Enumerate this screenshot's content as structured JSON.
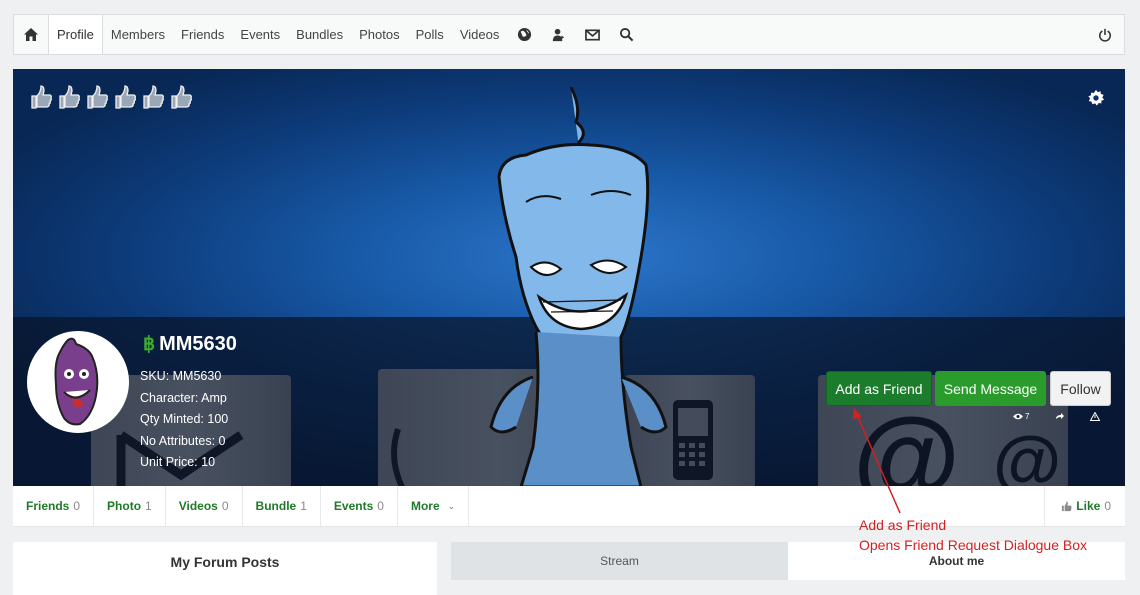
{
  "nav": {
    "items": [
      "Profile",
      "Members",
      "Friends",
      "Events",
      "Bundles",
      "Photos",
      "Polls",
      "Videos"
    ],
    "icons": [
      "globe-icon",
      "user-pin-icon",
      "envelope-icon",
      "search-icon"
    ]
  },
  "profile": {
    "coin_symbol": "฿",
    "name": "MM5630",
    "sku": "SKU: MM5630",
    "character": "Character: Amp",
    "qty": "Qty Minted: 100",
    "attributes": "No Attributes: 0",
    "price": "Unit Price: 10"
  },
  "actions": {
    "add_friend": "Add as Friend",
    "send_message": "Send Message",
    "follow": "Follow",
    "views": "7"
  },
  "tabs": [
    {
      "label": "Friends",
      "count": "0"
    },
    {
      "label": "Photo",
      "count": "1"
    },
    {
      "label": "Videos",
      "count": "0"
    },
    {
      "label": "Bundle",
      "count": "1"
    },
    {
      "label": "Events",
      "count": "0"
    },
    {
      "label": "More",
      "count": ""
    }
  ],
  "like": {
    "label": "Like",
    "count": "0"
  },
  "panels": {
    "forum": "My Forum Posts",
    "stream": "Stream",
    "about": "About me"
  },
  "annotation": {
    "line1": "Add as Friend",
    "line2": "Opens Friend Request Dialogue Box",
    "color": "#d42020"
  },
  "colors": {
    "green_primary": "#1b7d2c",
    "green_secondary": "#2a9c2c",
    "link_green": "#1f7a28"
  }
}
